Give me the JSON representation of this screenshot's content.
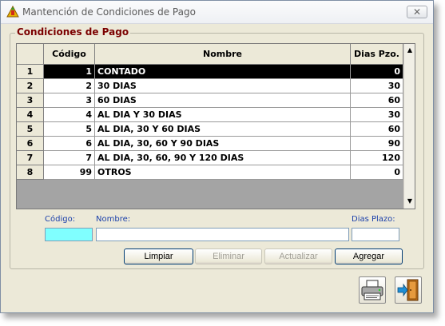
{
  "window": {
    "title": "Mantención de Condiciones de Pago",
    "close_glyph": "✕"
  },
  "group": {
    "title": "Condiciones de Pago"
  },
  "grid": {
    "columns": [
      "Código",
      "Nombre",
      "Dias Pzo."
    ],
    "rows": [
      {
        "row": "1",
        "codigo": "1",
        "nombre": "CONTADO",
        "dias": "0"
      },
      {
        "row": "2",
        "codigo": "2",
        "nombre": "30 DIAS",
        "dias": "30"
      },
      {
        "row": "3",
        "codigo": "3",
        "nombre": "60 DIAS",
        "dias": "60"
      },
      {
        "row": "4",
        "codigo": "4",
        "nombre": "AL DIA Y 30 DIAS",
        "dias": "30"
      },
      {
        "row": "5",
        "codigo": "5",
        "nombre": "AL DIA, 30 Y 60 DIAS",
        "dias": "60"
      },
      {
        "row": "6",
        "codigo": "6",
        "nombre": "AL DIA, 30, 60 Y 90 DIAS",
        "dias": "90"
      },
      {
        "row": "7",
        "codigo": "7",
        "nombre": "AL DIA, 30, 60, 90 Y 120 DIAS",
        "dias": "120"
      },
      {
        "row": "8",
        "codigo": "99",
        "nombre": "OTROS",
        "dias": "0"
      }
    ],
    "selected_row": "1"
  },
  "form": {
    "codigo_label": "Código:",
    "nombre_label": "Nombre:",
    "dias_label": "Dias Plazo:",
    "codigo_value": "",
    "nombre_value": "",
    "dias_value": ""
  },
  "buttons": {
    "limpiar": "Limpiar",
    "eliminar": "Eliminar",
    "actualizar": "Actualizar",
    "agregar": "Agregar"
  },
  "icons": {
    "app": "app-icon",
    "print": "printer-icon",
    "exit": "exit-door-icon"
  },
  "colors": {
    "codigo_field_bg": "#80ffff",
    "group_title": "#7b0000",
    "label_blue": "#1a3faa"
  }
}
